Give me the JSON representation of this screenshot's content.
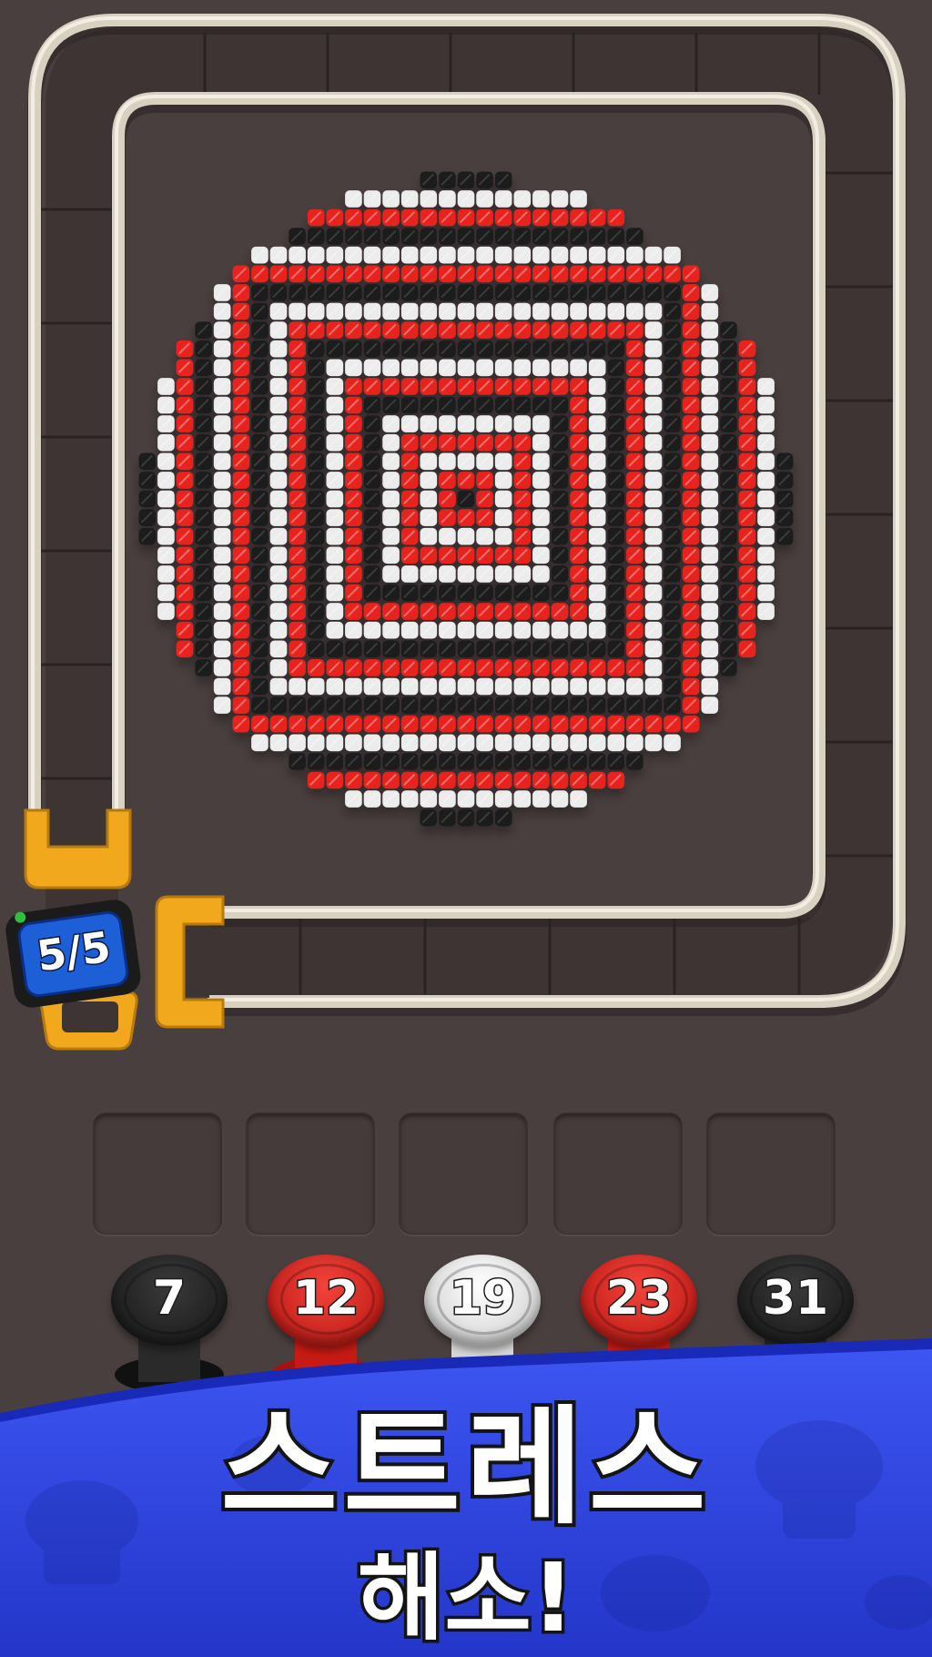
{
  "game": {
    "counter": "5/5",
    "pattern_colors": {
      "red": "#e8241f",
      "white": "#ececec",
      "black": "#1e1e1e"
    },
    "track_color": "#d8d0c0",
    "gate_color": "#f2a81d",
    "counter_color": "#1d5fd6"
  },
  "spools": [
    {
      "number": "7",
      "color": "#1e1e1e",
      "label": "black"
    },
    {
      "number": "12",
      "color": "#e0201a",
      "label": "red"
    },
    {
      "number": "19",
      "color": "#e6e6e6",
      "label": "white"
    },
    {
      "number": "23",
      "color": "#e0201a",
      "label": "red"
    },
    {
      "number": "31",
      "color": "#1e1e1e",
      "label": "black"
    }
  ],
  "slots": {
    "count": 5
  },
  "promo": {
    "headline": "스트레스",
    "subline": "해소!",
    "banner_color": "#2f45e8"
  }
}
